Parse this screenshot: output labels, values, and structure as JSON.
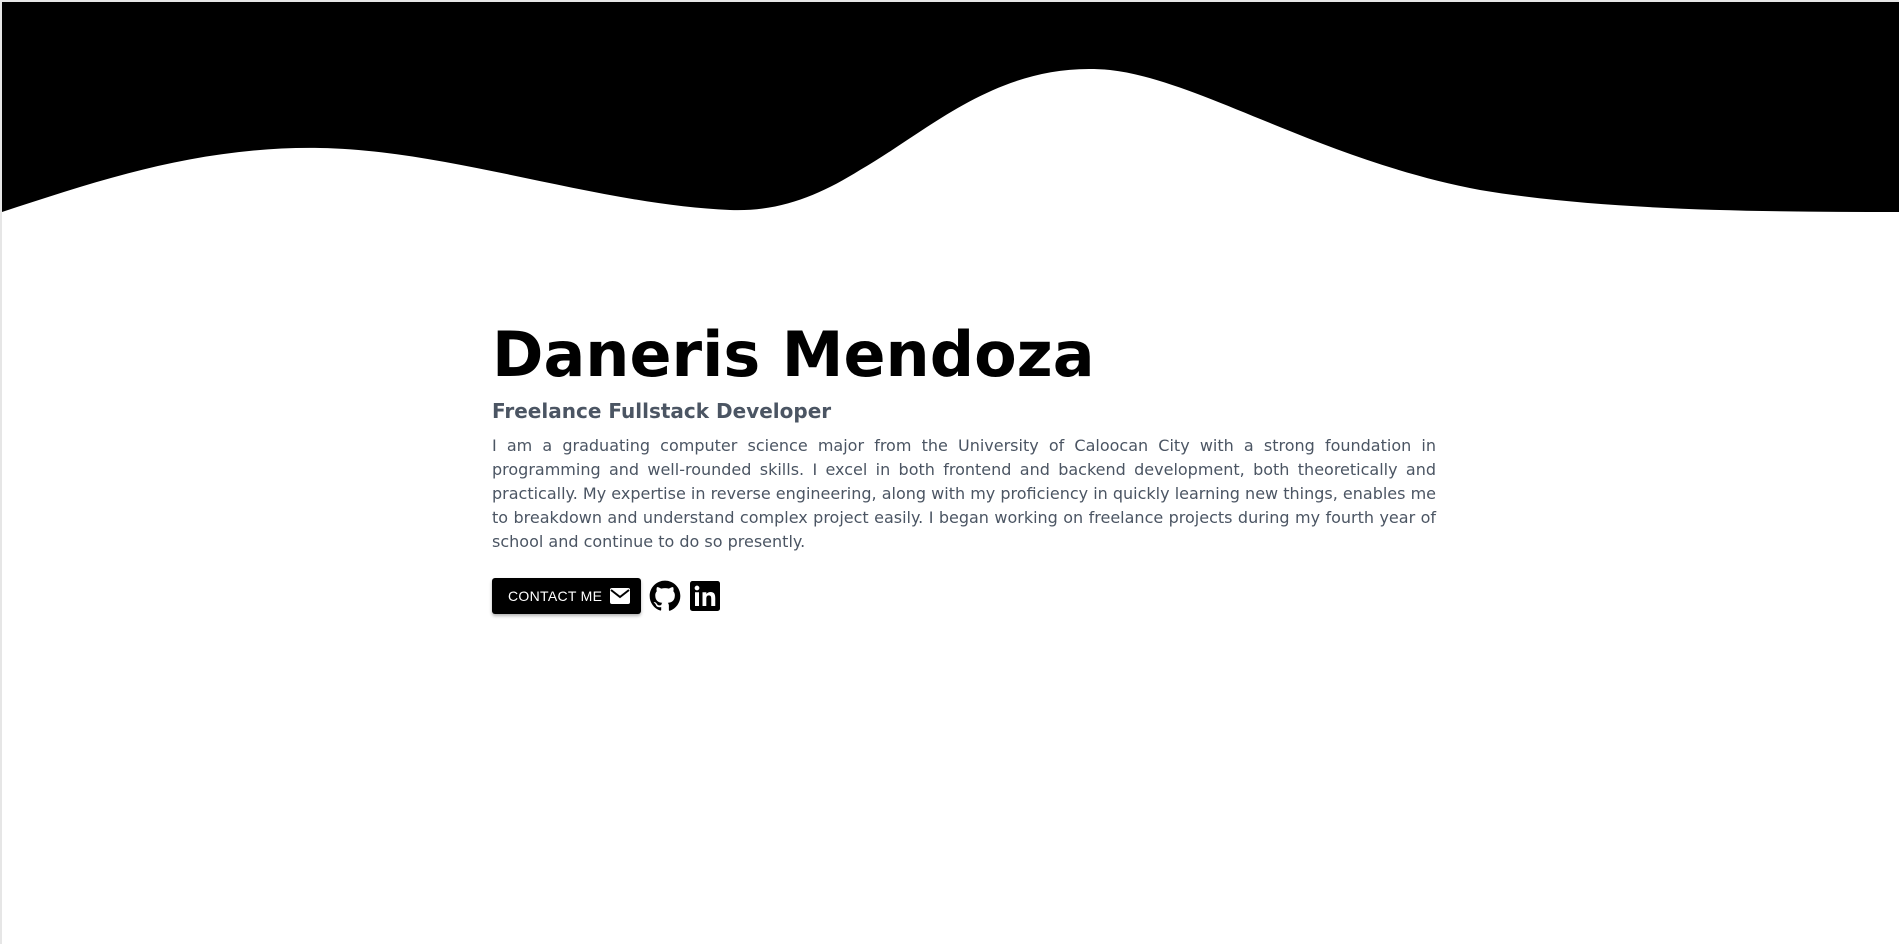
{
  "hero": {
    "name": "Daneris Mendoza",
    "title": "Freelance Fullstack Developer",
    "bio": "I am a graduating computer science major from the University of Caloocan City with a strong foundation in programming and well-rounded skills. I excel in both frontend and backend development, both theoretically and practically. My expertise in reverse engineering, along with my proficiency in quickly learning new things, enables me to breakdown and understand complex project easily. I began working on freelance projects during my fourth year of school and continue to do so presently."
  },
  "actions": {
    "contact_label": "CONTACT ME",
    "contact_icon": "envelope-icon",
    "social_links": [
      {
        "icon": "github-icon"
      },
      {
        "icon": "linkedin-icon"
      }
    ]
  },
  "colors": {
    "wave": "#000000",
    "background": "#ffffff",
    "heading": "#000000",
    "text": "#4b5563",
    "button_bg": "#000000",
    "button_text": "#ffffff"
  }
}
